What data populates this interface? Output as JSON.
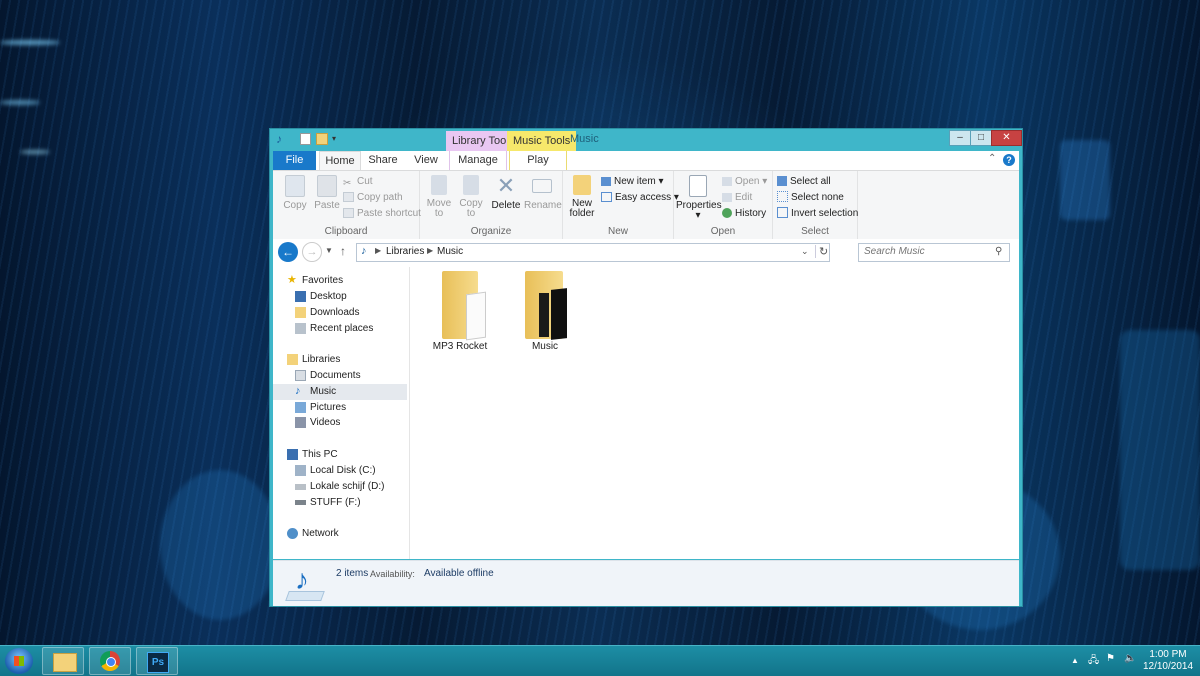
{
  "window": {
    "title": "Music",
    "contextual_tabs": {
      "library_tools": "Library Tools",
      "music_tools": "Music Tools"
    },
    "caption_buttons": {
      "minimize": "–",
      "maximize": "□",
      "close": "✕"
    }
  },
  "ribbon": {
    "tabs": {
      "file": "File",
      "home": "Home",
      "share": "Share",
      "view": "View",
      "manage": "Manage",
      "play": "Play"
    },
    "clipboard": {
      "copy": "Copy",
      "paste": "Paste",
      "cut": "Cut",
      "copy_path": "Copy path",
      "paste_shortcut": "Paste shortcut",
      "label": "Clipboard"
    },
    "organize": {
      "move_to": "Move",
      "move_to_2": "to",
      "copy_to": "Copy",
      "copy_to_2": "to",
      "delete": "Delete",
      "rename": "Rename",
      "label": "Organize"
    },
    "new": {
      "new_folder": "New",
      "new_folder_2": "folder",
      "new_item": "New item",
      "easy_access": "Easy access",
      "label": "New"
    },
    "open": {
      "properties": "Properties",
      "open": "Open",
      "edit": "Edit",
      "history": "History",
      "label": "Open"
    },
    "select": {
      "select_all": "Select all",
      "select_none": "Select none",
      "invert_selection": "Invert selection",
      "label": "Select"
    }
  },
  "address_bar": {
    "crumb_1": "Libraries",
    "crumb_2": "Music",
    "search_placeholder": "Search Music"
  },
  "nav": {
    "favorites": "Favorites",
    "desktop": "Desktop",
    "downloads": "Downloads",
    "recent_places": "Recent places",
    "libraries": "Libraries",
    "documents": "Documents",
    "music": "Music",
    "pictures": "Pictures",
    "videos": "Videos",
    "this_pc": "This PC",
    "local_disk": "Local Disk (C:)",
    "lokale_schijf": "Lokale schijf (D:)",
    "stuff": "STUFF (F:)",
    "network": "Network"
  },
  "files": [
    {
      "name": "MP3 Rocket"
    },
    {
      "name": "Music"
    }
  ],
  "status": {
    "count": "2 items",
    "availability_label": "Availability:",
    "availability_value": "Available offline"
  },
  "taskbar": {
    "time": "1:00 PM",
    "date": "12/10/2014"
  },
  "colors": {
    "accent": "#3fb6c9",
    "file_tab": "#1979ca",
    "library_tools": "#e9c7f2",
    "music_tools": "#f6e86b",
    "folder": "#f3d27a"
  }
}
